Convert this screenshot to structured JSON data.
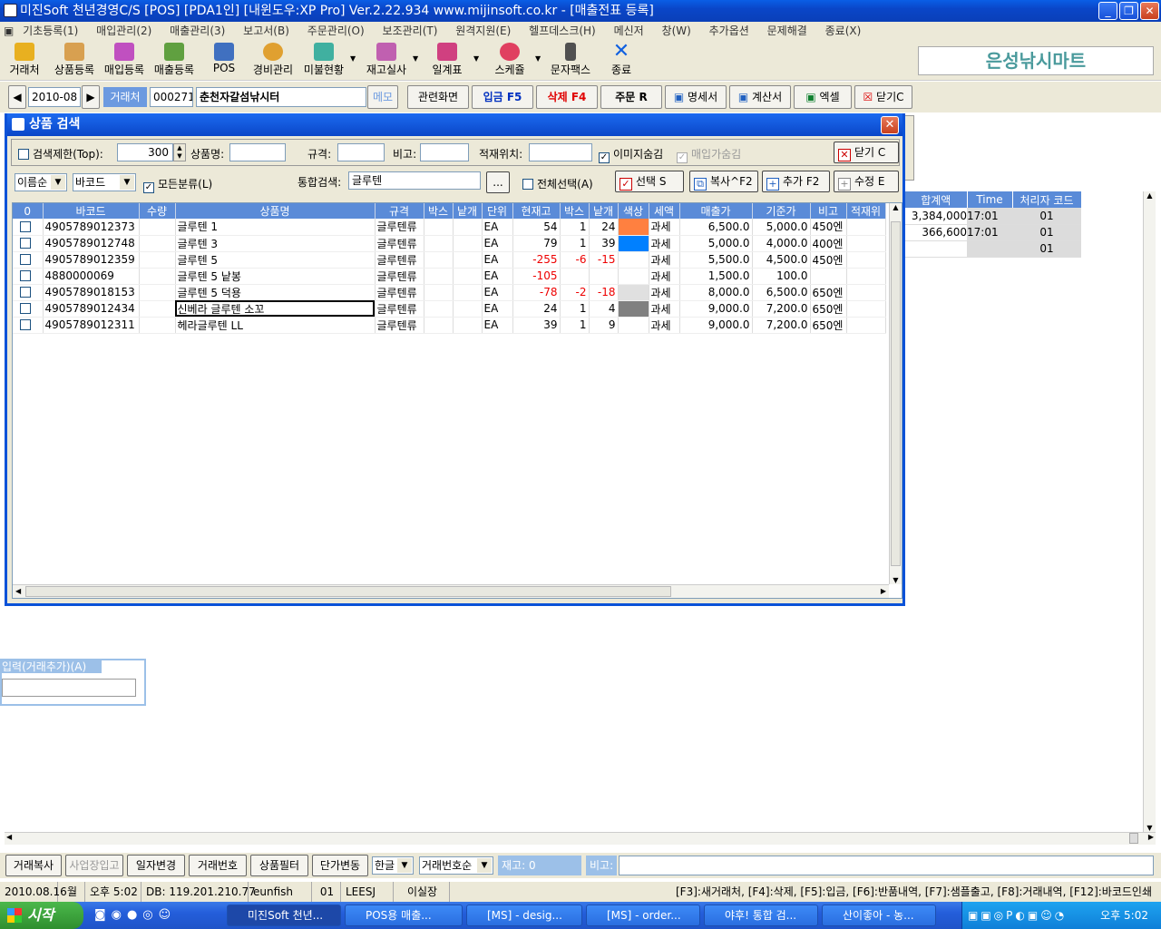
{
  "window": {
    "title": "미진Soft 천년경영C/S [POS] [PDA1인] [내윈도우:XP Pro] Ver.2.22.934          www.mijinsoft.co.kr - [매출전표 등록]"
  },
  "menu": [
    "기초등록(1)",
    "매입관리(2)",
    "매출관리(3)",
    "보고서(B)",
    "주문관리(O)",
    "보조관리(T)",
    "원격지원(E)",
    "헬프데스크(H)",
    "메신저",
    "창(W)",
    "추가옵션",
    "문제해결",
    "종료(X)"
  ],
  "toolbar": [
    "거래처",
    "상품등록",
    "매입등록",
    "매출등록",
    "POS",
    "경비관리",
    "미불현황",
    "재고실사",
    "일계표",
    "스케쥴",
    "문자팩스",
    "종료"
  ],
  "brand": "은성낚시마트",
  "nav": {
    "date": "2010-08",
    "client_label": "거래처",
    "client_code": "000271",
    "client_name": "춘천자갈섬낚시터",
    "memo": "메모",
    "buttons": [
      "관련화면",
      "입금 F5",
      "삭제 F4",
      "주문 R",
      "명세서",
      "계산서",
      "엑셀",
      "닫기C"
    ]
  },
  "dialog": {
    "title": "상품 검색",
    "search_limit_label": "검색제한(Top):",
    "search_limit_value": "300",
    "product_name_label": "상품명:",
    "spec_label": "규격:",
    "note_label": "비고:",
    "location_label": "적재위치:",
    "hide_image_label": "이미지숨김",
    "hide_purchase_label": "매입가숨김",
    "close_label": "닫기 C",
    "sort_select": "이름순",
    "barcode_select": "바코드",
    "all_category_label": "모든분류(L)",
    "integrated_search_label": "통합검색:",
    "integrated_search_value": "글루텐",
    "ellipsis": "...",
    "select_all_label": "전체선택(A)",
    "select_btn": "선택 S",
    "copy_btn": "복사^F2",
    "add_btn": "추가 F2",
    "edit_btn": "수정 E"
  },
  "grid": {
    "columns": [
      "0",
      "바코드",
      "수량",
      "상품명",
      "규격",
      "박스",
      "낱개",
      "단위",
      "현재고",
      "박스",
      "낱개",
      "색상",
      "세액",
      "매출가",
      "기준가",
      "비고",
      "적재위"
    ],
    "rows": [
      {
        "barcode": "4905789012373",
        "qty": "",
        "name": "글루텐 1",
        "spec": "글루텐류",
        "box": "",
        "each": "",
        "unit": "EA",
        "stock": "54",
        "sbox": "1",
        "seach": "24",
        "color": "#ff8040",
        "tax": "과세",
        "price": "6,500.0",
        "base": "5,000.0",
        "note": "450엔",
        "neg": false
      },
      {
        "barcode": "4905789012748",
        "qty": "",
        "name": "글루텐 3",
        "spec": "글루텐류",
        "box": "",
        "each": "",
        "unit": "EA",
        "stock": "79",
        "sbox": "1",
        "seach": "39",
        "color": "#0080ff",
        "tax": "과세",
        "price": "5,000.0",
        "base": "4,000.0",
        "note": "400엔",
        "neg": false
      },
      {
        "barcode": "4905789012359",
        "qty": "",
        "name": "글루텐 5",
        "spec": "글루텐류",
        "box": "",
        "each": "",
        "unit": "EA",
        "stock": "-255",
        "sbox": "-6",
        "seach": "-15",
        "color": "#ffffff",
        "tax": "과세",
        "price": "5,500.0",
        "base": "4,500.0",
        "note": "450엔",
        "neg": true
      },
      {
        "barcode": "4880000069",
        "qty": "",
        "name": "글루텐 5 낱봉",
        "spec": "글루텐류",
        "box": "",
        "each": "",
        "unit": "EA",
        "stock": "-105",
        "sbox": "",
        "seach": "",
        "color": "#ffffff",
        "tax": "과세",
        "price": "1,500.0",
        "base": "100.0",
        "note": "",
        "neg": true
      },
      {
        "barcode": "4905789018153",
        "qty": "",
        "name": "글루텐 5 덕용",
        "spec": "글루텐류",
        "box": "",
        "each": "",
        "unit": "EA",
        "stock": "-78",
        "sbox": "-2",
        "seach": "-18",
        "color": "#e0e0e0",
        "tax": "과세",
        "price": "8,000.0",
        "base": "6,500.0",
        "note": "650엔",
        "neg": true
      },
      {
        "barcode": "4905789012434",
        "qty": "",
        "name": "신베라 글루텐 소꼬",
        "spec": "글루텐류",
        "box": "",
        "each": "",
        "unit": "EA",
        "stock": "24",
        "sbox": "1",
        "seach": "4",
        "color": "#808080",
        "tax": "과세",
        "price": "9,000.0",
        "base": "7,200.0",
        "note": "650엔",
        "neg": false
      },
      {
        "barcode": "4905789012311",
        "qty": "",
        "name": "헤라글루텐 LL",
        "spec": "글루텐류",
        "box": "",
        "each": "",
        "unit": "EA",
        "stock": "39",
        "sbox": "1",
        "seach": "9",
        "color": "#ffffff",
        "tax": "과세",
        "price": "9,000.0",
        "base": "7,200.0",
        "note": "650엔",
        "neg": false
      }
    ]
  },
  "right_table": {
    "columns": [
      "합계액",
      "Time",
      "처리자 코드"
    ],
    "rows": [
      [
        "3,384,000",
        "17:01",
        "01"
      ],
      [
        "366,600",
        "17:01",
        "01"
      ],
      [
        "",
        "",
        "01"
      ]
    ]
  },
  "left_panel": {
    "label": "입력(거래추가)(A)"
  },
  "bottom_buttons": [
    "거래복사",
    "사업장입고",
    "일자변경",
    "거래번호",
    "상품필터",
    "단가변동"
  ],
  "bottom_selects": [
    "한글",
    "거래번호순"
  ],
  "stock_label": "재고: 0",
  "note_label": "비고:",
  "status": [
    "2010.08.16",
    "월",
    "오후 5:02",
    "DB: 119.201.210.77",
    "eunfish",
    "01",
    "LEESJ",
    "이실장",
    "[F3]:새거래처, [F4]:삭제, [F5]:입금, [F6]:반품내역, [F7]:샘플출고, [F8]:거래내역, [F12]:바코드인쇄"
  ],
  "taskbar": {
    "start": "시작",
    "tasks": [
      "미진Soft 천년...",
      "POS용 매출...",
      "[MS] - desig...",
      "[MS] - order...",
      "야후! 통합 검...",
      "산이좋아 - 농..."
    ],
    "clock": "오후 5:02"
  }
}
